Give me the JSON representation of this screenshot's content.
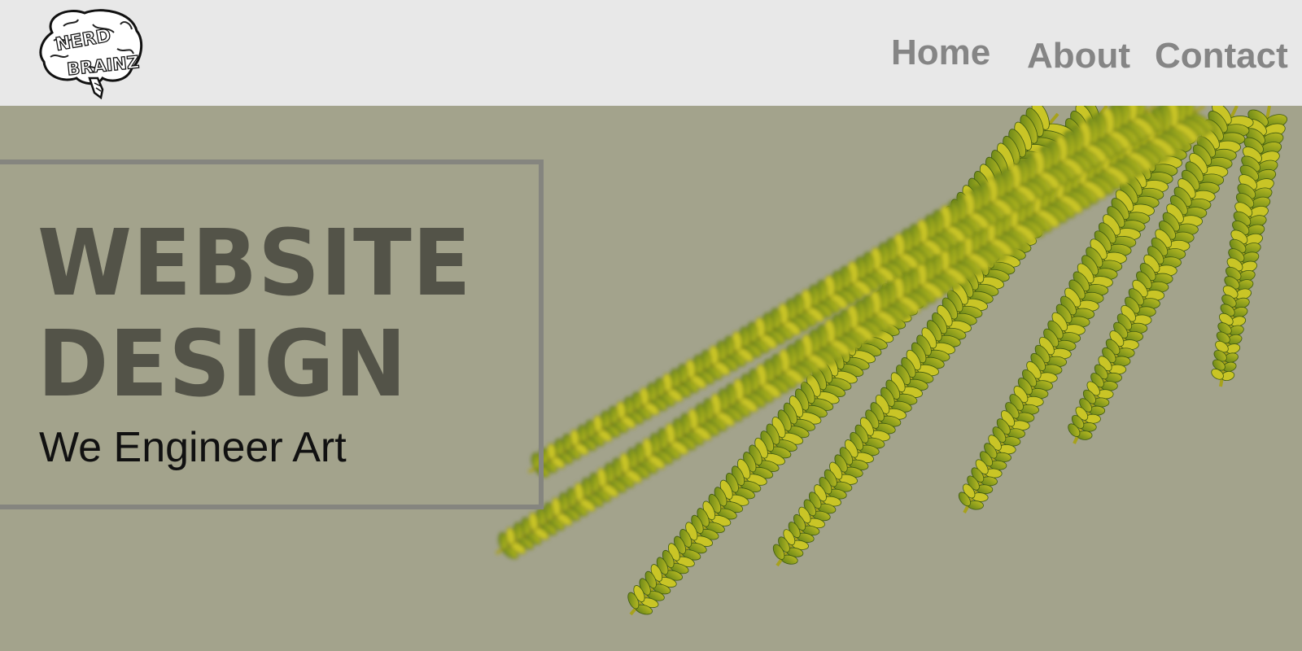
{
  "header": {
    "logo": {
      "icon": "brain-logo-icon",
      "text_line1": "NERD",
      "text_line2": "BRAINZ"
    },
    "nav": [
      {
        "label": "Home"
      },
      {
        "label": "About"
      },
      {
        "label": "Contact"
      }
    ]
  },
  "hero": {
    "title_line1": "WEBSITE",
    "title_line2": "DESIGN",
    "tagline": "We Engineer Art",
    "image": "fern-branch-image"
  },
  "colors": {
    "header_bg": "#e8e8e8",
    "hero_bg": "#a3a38c",
    "nav_text": "#858585",
    "title_text": "#535348",
    "frame_border": "#85857f",
    "leaf_green": "#6b8a1c",
    "leaf_yellow": "#b8b820"
  }
}
